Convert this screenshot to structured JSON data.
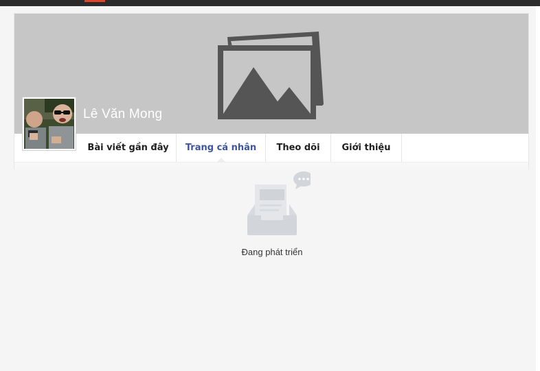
{
  "profile": {
    "name": "Lê Văn Mong"
  },
  "tabs": [
    {
      "label": "Bài viết gần đây",
      "active": false
    },
    {
      "label": "Trang cá nhân",
      "active": true
    },
    {
      "label": "Theo dõi",
      "active": false
    },
    {
      "label": "Giới thiệu",
      "active": false
    }
  ],
  "empty_state": {
    "message": "Đang phát triển",
    "icon": "inbox-chat-icon"
  },
  "cover": {
    "icon": "image-placeholder-icon"
  },
  "colors": {
    "topbar": "#2b2b2b",
    "cover_bg": "#c6c6c6",
    "active_tab": "#3d55a0"
  }
}
